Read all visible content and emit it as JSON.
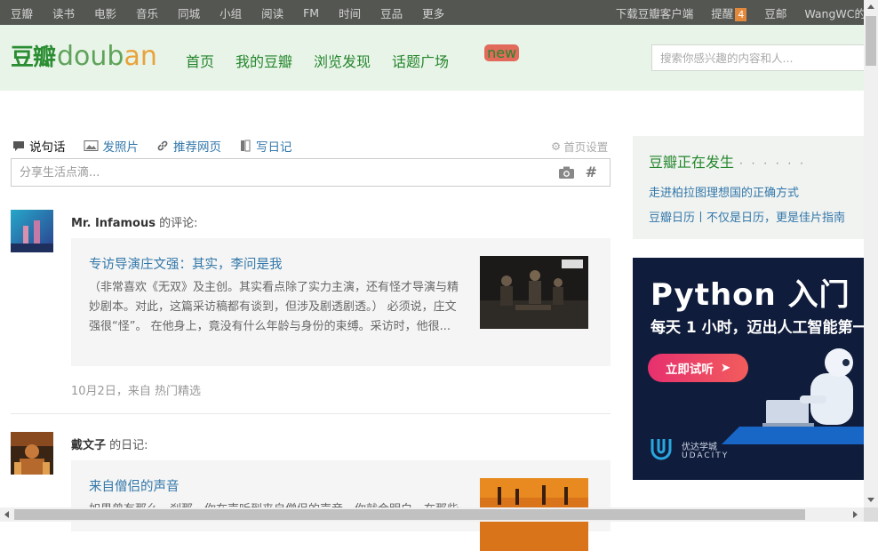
{
  "topbar": {
    "left_items": [
      "豆瓣",
      "读书",
      "电影",
      "音乐",
      "同城",
      "小组",
      "阅读",
      "FM",
      "时间",
      "豆品",
      "更多"
    ],
    "download": "下载豆瓣客户端",
    "remind": "提醒",
    "remind_count": "4",
    "mail": "豆邮",
    "user": "WangWC的"
  },
  "header": {
    "logo_zh": "豆瓣",
    "logo_en_1": "doub",
    "logo_en_2": "an",
    "nav": [
      "首页",
      "我的豆瓣",
      "浏览发现",
      "话题广场"
    ],
    "new_tag": "new",
    "search_placeholder": "搜索你感兴趣的内容和人..."
  },
  "composer": {
    "tabs": [
      "说句话",
      "发照片",
      "推荐网页",
      "写日记"
    ],
    "home_settings": "首页设置",
    "placeholder": "分享生活点滴...",
    "hash": "#"
  },
  "feed": [
    {
      "user": "Mr. Infamous",
      "action": "的评论:",
      "title": "专访导演庄文强：其实，李问是我",
      "excerpt": "（非常喜欢《无双》及主创。其实看点除了实力主演，还有怪才导演与精妙剧本。对此，这篇采访稿都有谈到，但涉及剧透剧透。） 必须说，庄文强很“怪”。 在他身上，竟没有什么年龄与身份的束缚。采访时，他很...",
      "meta": "10月2日，来自 热门精选"
    },
    {
      "user": "戴文子",
      "action": "的日记:",
      "title": "来自僧侣的声音",
      "excerpt": "如果曾有那么一刹那，你在声听到来自僧侣的声音，你就会明白，在那些"
    }
  ],
  "sidebar": {
    "happening_title": "豆瓣正在发生",
    "happening_dots": "· · · · · ·",
    "links": [
      "走进柏拉图理想国的正确方式",
      "豆瓣日历丨不仅是日历，更是佳片指南"
    ]
  },
  "ad": {
    "title": "Python 入门",
    "subtitle": "每天 1 小时，迈出人工智能第一",
    "button": "立即试听",
    "brand_zh": "优达学城",
    "brand_en": "UDACITY"
  },
  "colors": {
    "topbar_bg": "#545652",
    "header_bg": "#e9f4e9",
    "brand_green": "#24862c",
    "link_blue": "#3377aa",
    "badge_orange": "#e3893b"
  }
}
